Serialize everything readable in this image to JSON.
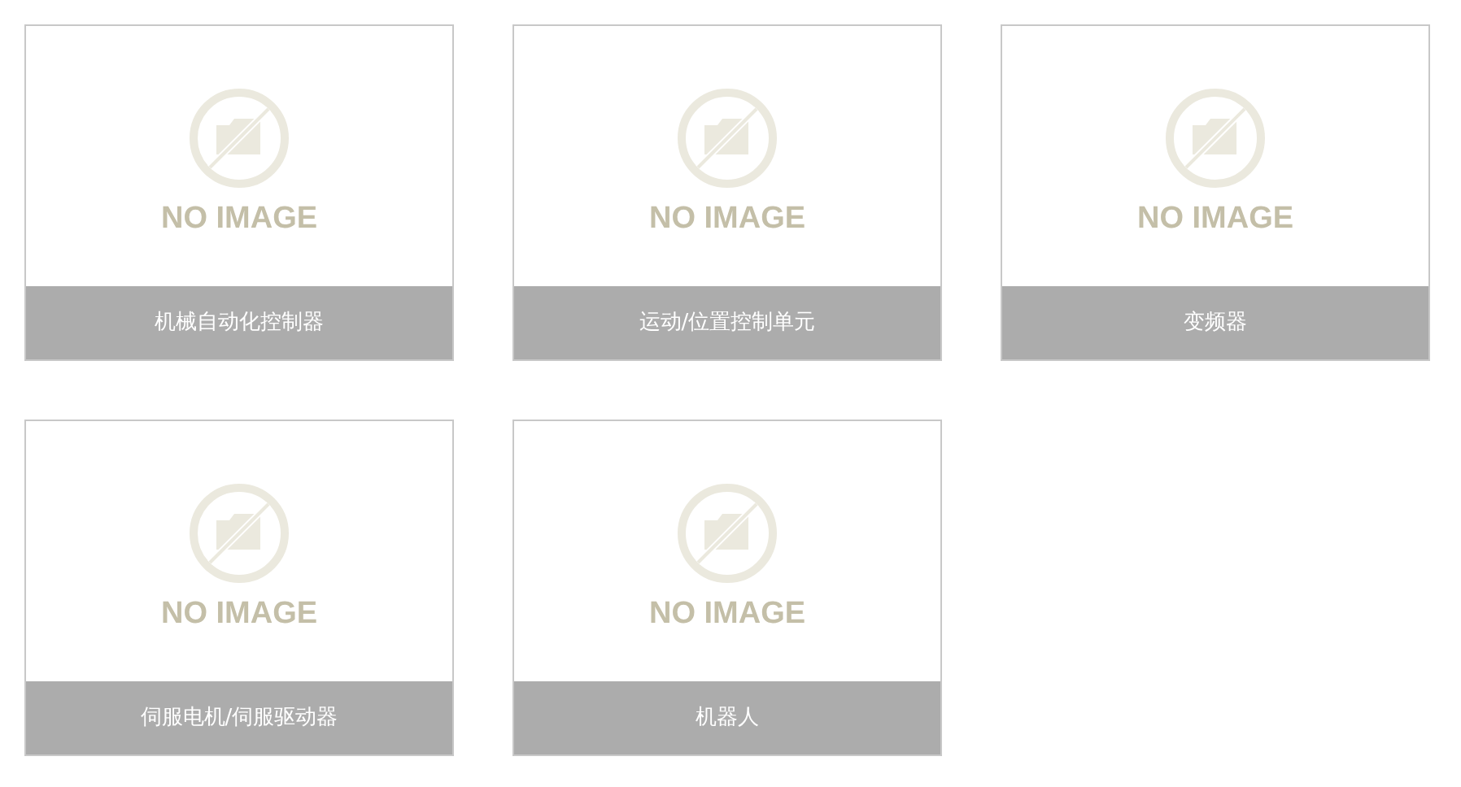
{
  "cards": [
    {
      "placeholder_text": "NO IMAGE",
      "caption": "机械自动化控制器"
    },
    {
      "placeholder_text": "NO IMAGE",
      "caption": "运动/位置控制单元"
    },
    {
      "placeholder_text": "NO IMAGE",
      "caption": "变频器"
    },
    {
      "placeholder_text": "NO IMAGE",
      "caption": "伺服电机/伺服驱动器"
    },
    {
      "placeholder_text": "NO IMAGE",
      "caption": "机器人"
    }
  ]
}
